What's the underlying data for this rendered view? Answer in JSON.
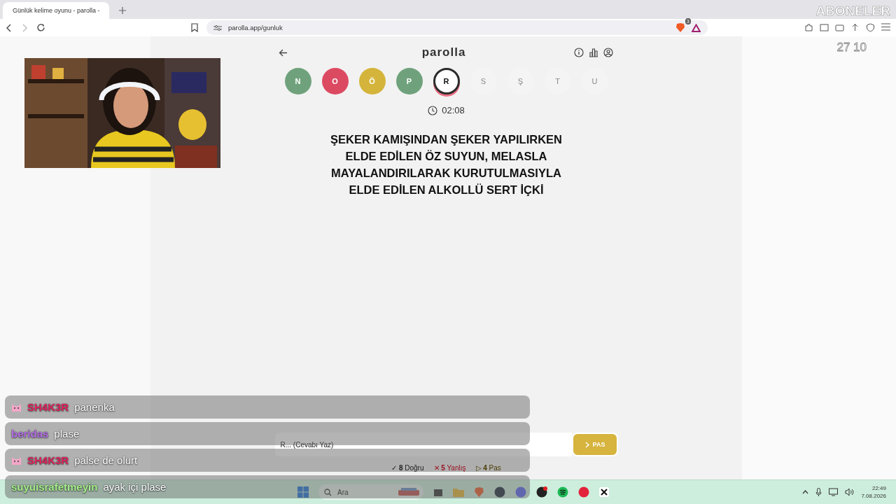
{
  "browser": {
    "tab_title": "Günlük kelime oyunu - parolla -",
    "url": "parolla.app/gunluk",
    "shield_count": "3"
  },
  "overlay": {
    "label": "ABONELER",
    "count": "27 10"
  },
  "game": {
    "title": "parolla",
    "letters": [
      {
        "char": "N",
        "color": "#6fa27c",
        "selected": false
      },
      {
        "char": "O",
        "color": "#dc4a62",
        "selected": false
      },
      {
        "char": "Ö",
        "color": "#d4b43a",
        "selected": false
      },
      {
        "char": "P",
        "color": "#6fa27c",
        "selected": false
      },
      {
        "char": "R",
        "color": "#ffffff",
        "selected": true
      },
      {
        "char": "S",
        "color": "#f4f4f4",
        "selected": false
      },
      {
        "char": "Ş",
        "color": "#f4f4f4",
        "selected": false
      },
      {
        "char": "T",
        "color": "#f4f4f4",
        "selected": false
      },
      {
        "char": "U",
        "color": "#f4f4f4",
        "selected": false
      }
    ],
    "timer": "02:08",
    "question": "ŞEKER KAMIŞINDAN ŞEKER YAPILIRKEN ELDE EDİLEN ÖZ SUYUN, MELASLA MAYALANDIRILARAK KURUTULMASIYLA ELDE EDİLEN ALKOLLÜ SERT İÇKİ",
    "answer": {
      "placeholder": "R... (Cevabı Yaz)"
    },
    "pass_button": "PAS",
    "stats": [
      {
        "kind": "correct",
        "icon": "✓",
        "count": "8",
        "label": "Doğru"
      },
      {
        "kind": "wrong",
        "icon": "✕",
        "count": "5",
        "label": "Yanlış"
      },
      {
        "kind": "pass",
        "icon": "▷",
        "count": "4",
        "label": "Pas"
      }
    ]
  },
  "chat": [
    {
      "user": "SH4K3R",
      "color": "#e0245e",
      "badge": true,
      "message": "panenka"
    },
    {
      "user": "beridas",
      "color": "#b36ee6",
      "badge": false,
      "message": "plase"
    },
    {
      "user": "SH4K3R",
      "color": "#e0245e",
      "badge": true,
      "message": "palse de olurt"
    },
    {
      "user": "suyuisrafetmeyin",
      "color": "#a6f08a",
      "badge": false,
      "message": "ayak içi plase"
    }
  ],
  "taskbar": {
    "search": "Ara",
    "time": "22:49",
    "date": "7.08.2026"
  }
}
